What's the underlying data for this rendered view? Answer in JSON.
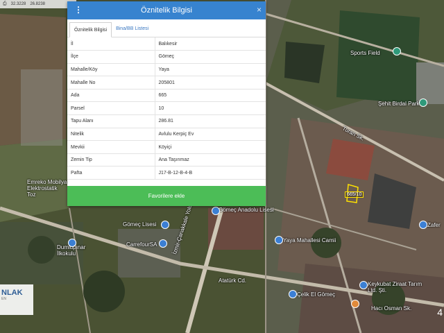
{
  "toolbar": {
    "print_icon": "printer-icon",
    "coord_x": "32.3228",
    "coord_y": "26.8238"
  },
  "panel": {
    "title": "Öznitelik Bilgisi",
    "menu_icon": "kebab-menu-icon",
    "close_icon": "close-icon",
    "tabs": [
      {
        "label": "Öznitelik Bilgisi",
        "active": true
      },
      {
        "label": "Bina/BB Listesi",
        "active": false
      }
    ],
    "rows": [
      {
        "key": "İl",
        "value": "Balıkesir"
      },
      {
        "key": "İlçe",
        "value": "Gömeç"
      },
      {
        "key": "Mahalle/Köy",
        "value": "Yaya"
      },
      {
        "key": "Mahalle No",
        "value": "205801"
      },
      {
        "key": "Ada",
        "value": "665"
      },
      {
        "key": "Parsel",
        "value": "10"
      },
      {
        "key": "Tapu Alanı",
        "value": "286.81"
      },
      {
        "key": "Nitelik",
        "value": "Avlulu Kerpiç Ev"
      },
      {
        "key": "Mevkii",
        "value": "Köyiçi"
      },
      {
        "key": "Zemin Tip",
        "value": "Ana Taşınmaz"
      },
      {
        "key": "Pafta",
        "value": "J17-B-12-B-4-B"
      }
    ],
    "favorite_button": "Favorilere ekle"
  },
  "map": {
    "labels": {
      "sports_field": "Sports Field",
      "sehit_birdal": "Şehit Birdal Parkı",
      "turan_sk": "Turan Sk.",
      "emreko": "Emreko Mobilya Elektrostatik Toz",
      "gomec_anadolu": "Gömeç Anadolu Lisesi",
      "gomec_lisesi": "Gömeç Lisesi",
      "carrefour": "CarrefourSA",
      "yaya_camii": "Yaya Mahallesi Camii",
      "izmir_canakkale": "İzmir-Çanakkale Yolu",
      "ataturk_cd": "Atatürk Cd.",
      "dumlupinar": "Dumlupınar İlkokulu",
      "keykubat": "Keykubat Ziraat Tarım Ltd. Şti.",
      "celik": "Çelik El Gömeç",
      "haci_osman": "Hacı Osman Sk.",
      "zafer": "Zafer",
      "parcel_badge": "665/10"
    },
    "brand": {
      "name": "NLAK",
      "sub": "EN"
    },
    "corner_number": "4"
  }
}
